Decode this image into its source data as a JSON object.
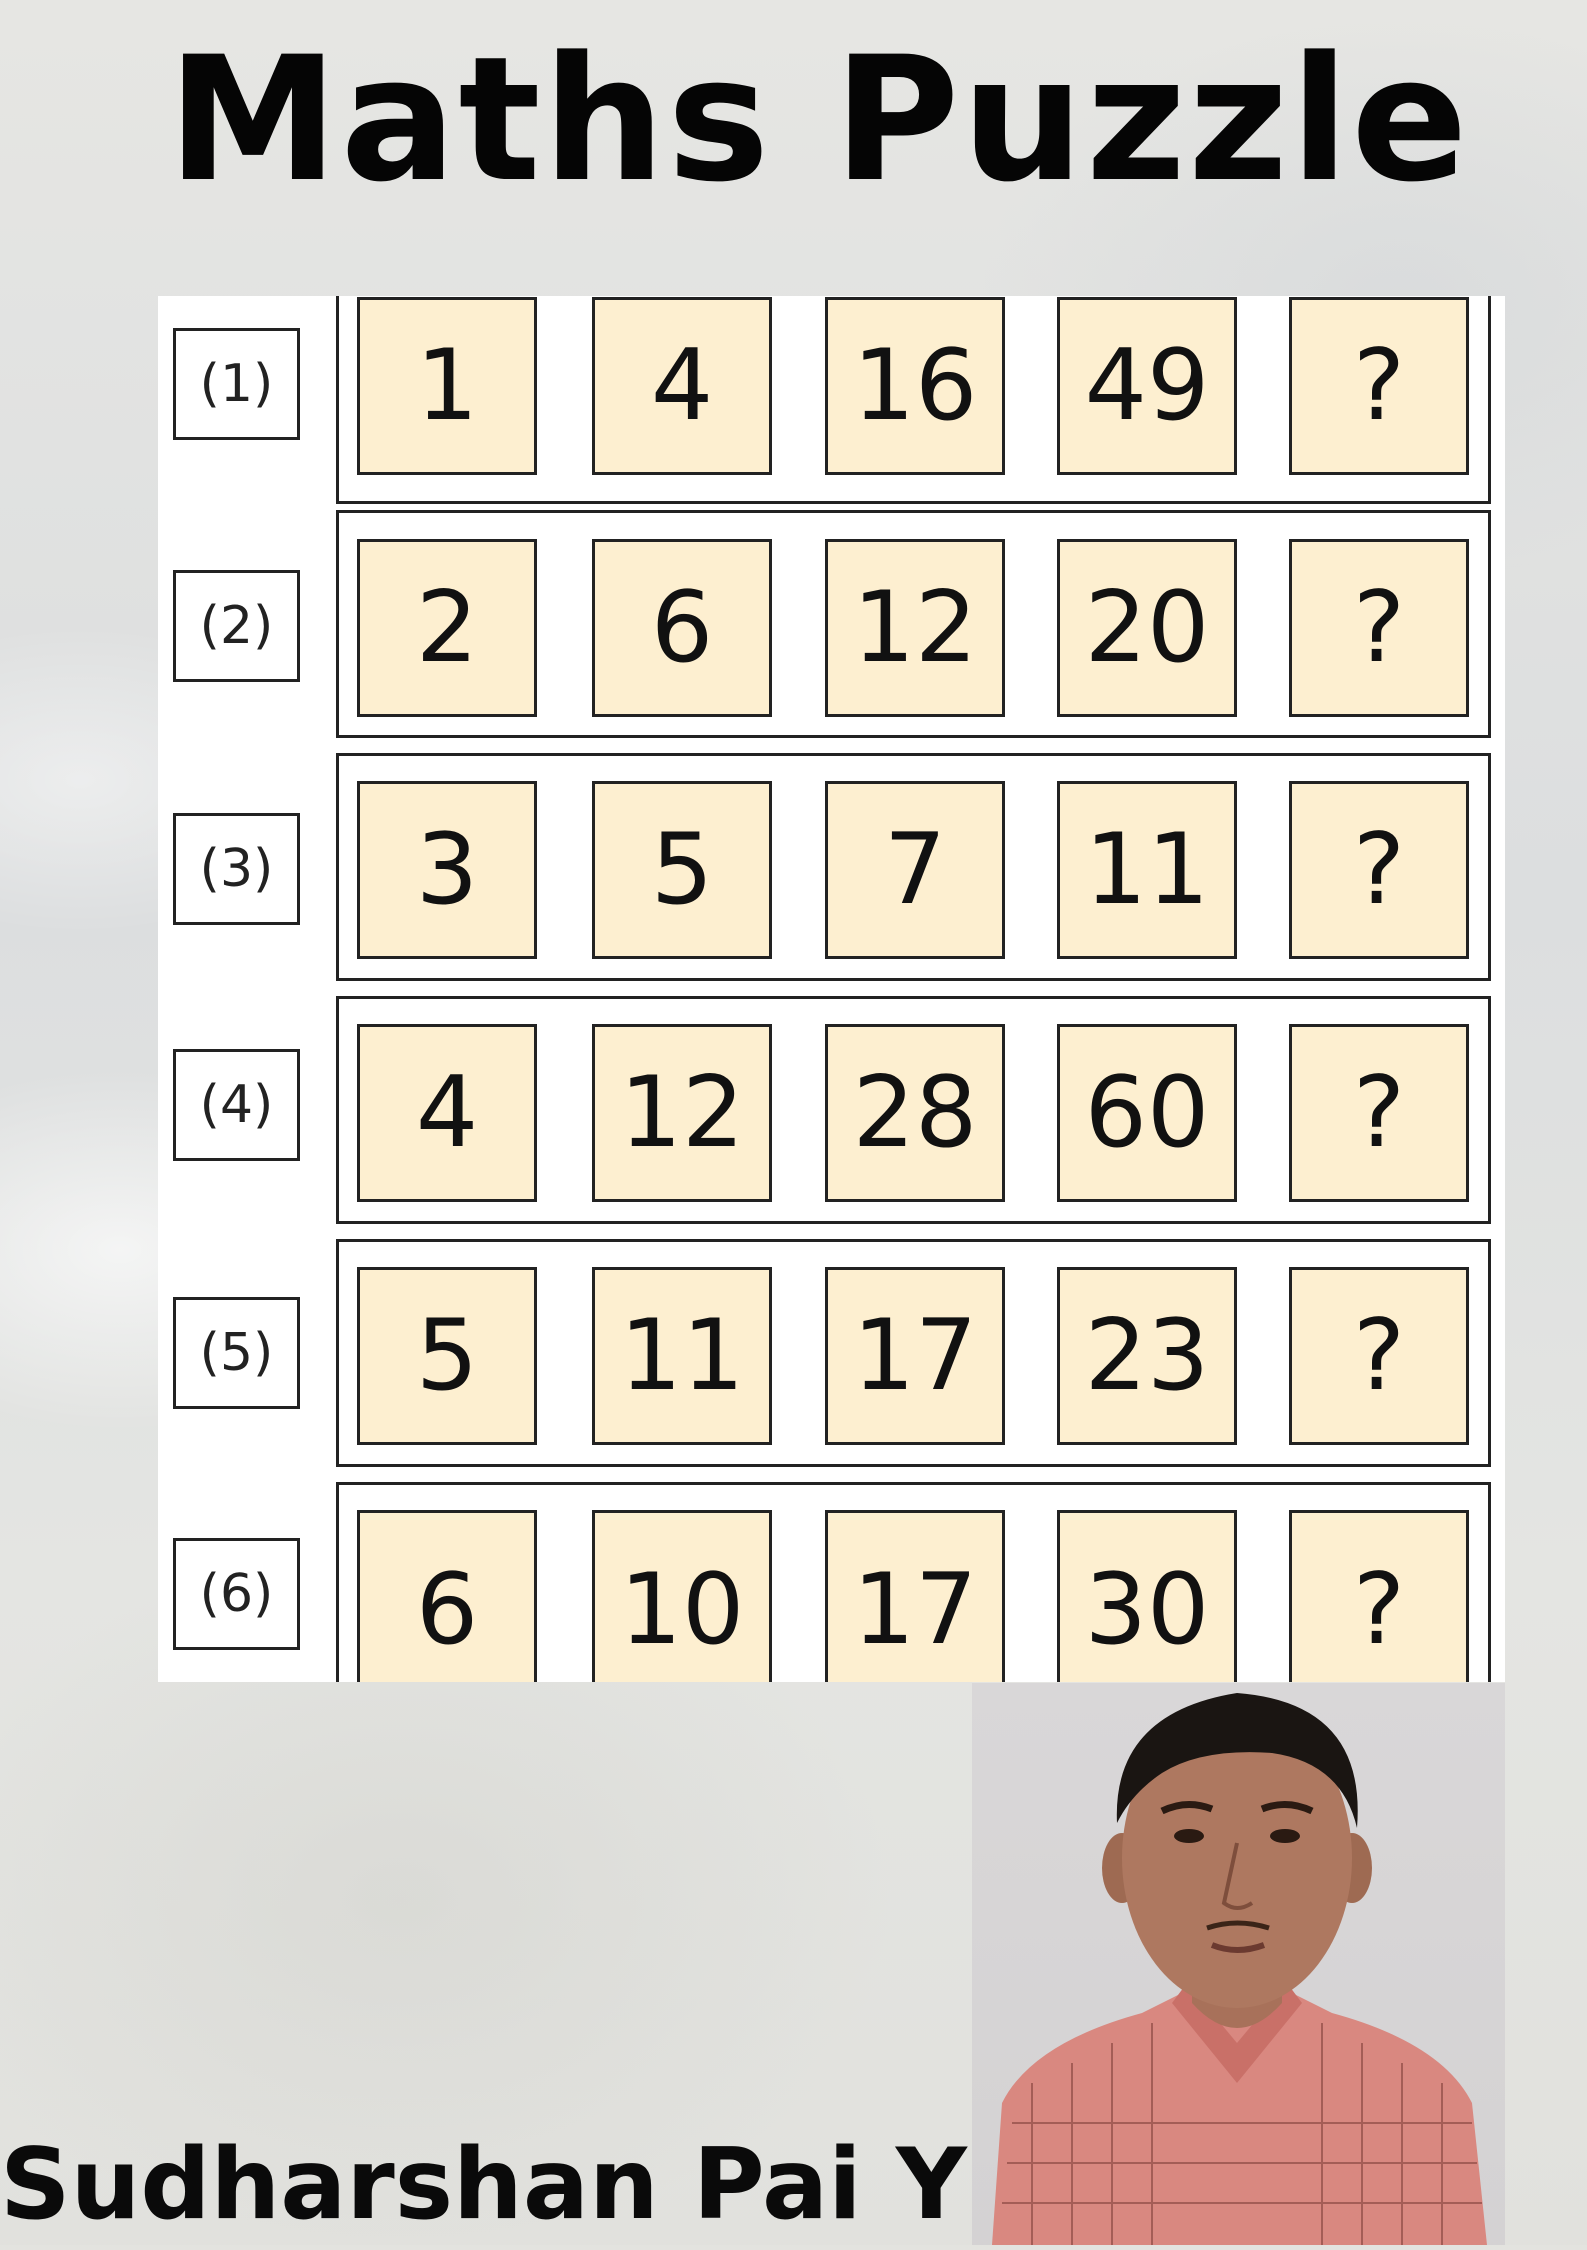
{
  "title": "Maths Puzzle",
  "author": "Sudharshan Pai Y",
  "puzzles": [
    {
      "label": "(1)",
      "values": [
        "1",
        "4",
        "16",
        "49",
        "?"
      ]
    },
    {
      "label": "(2)",
      "values": [
        "2",
        "6",
        "12",
        "20",
        "?"
      ]
    },
    {
      "label": "(3)",
      "values": [
        "3",
        "5",
        "7",
        "11",
        "?"
      ]
    },
    {
      "label": "(4)",
      "values": [
        "4",
        "12",
        "28",
        "60",
        "?"
      ]
    },
    {
      "label": "(5)",
      "values": [
        "5",
        "11",
        "17",
        "23",
        "?"
      ]
    },
    {
      "label": "(6)",
      "values": [
        "6",
        "10",
        "17",
        "30",
        "?"
      ]
    }
  ],
  "colors": {
    "cell_fill": "#fdefd0",
    "title_text": "#050505",
    "shirt": "#d98880"
  }
}
